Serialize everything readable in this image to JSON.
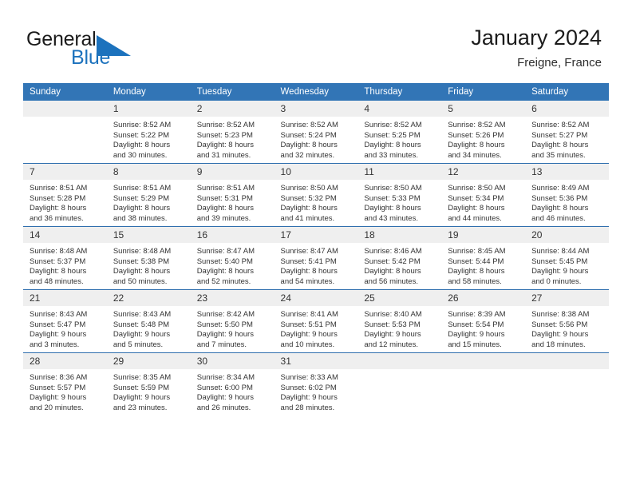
{
  "brand": {
    "name_part1": "General",
    "name_part2": "Blue",
    "triangle_color": "#1c72bd",
    "icon": "triangle-logo-icon"
  },
  "header": {
    "title": "January 2024",
    "location": "Freigne, France"
  },
  "theme": {
    "header_row_bg": "#3275b6",
    "daynum_bg": "#efefef",
    "row_divider": "#2f6fae",
    "accent": "#1c72bd"
  },
  "calendar": {
    "weekday_headers": [
      "Sunday",
      "Monday",
      "Tuesday",
      "Wednesday",
      "Thursday",
      "Friday",
      "Saturday"
    ],
    "weeks": [
      [
        {
          "day": "",
          "sunrise": "",
          "sunset": "",
          "daylight_line1": "",
          "daylight_line2": ""
        },
        {
          "day": "1",
          "sunrise": "Sunrise: 8:52 AM",
          "sunset": "Sunset: 5:22 PM",
          "daylight_line1": "Daylight: 8 hours",
          "daylight_line2": "and 30 minutes."
        },
        {
          "day": "2",
          "sunrise": "Sunrise: 8:52 AM",
          "sunset": "Sunset: 5:23 PM",
          "daylight_line1": "Daylight: 8 hours",
          "daylight_line2": "and 31 minutes."
        },
        {
          "day": "3",
          "sunrise": "Sunrise: 8:52 AM",
          "sunset": "Sunset: 5:24 PM",
          "daylight_line1": "Daylight: 8 hours",
          "daylight_line2": "and 32 minutes."
        },
        {
          "day": "4",
          "sunrise": "Sunrise: 8:52 AM",
          "sunset": "Sunset: 5:25 PM",
          "daylight_line1": "Daylight: 8 hours",
          "daylight_line2": "and 33 minutes."
        },
        {
          "day": "5",
          "sunrise": "Sunrise: 8:52 AM",
          "sunset": "Sunset: 5:26 PM",
          "daylight_line1": "Daylight: 8 hours",
          "daylight_line2": "and 34 minutes."
        },
        {
          "day": "6",
          "sunrise": "Sunrise: 8:52 AM",
          "sunset": "Sunset: 5:27 PM",
          "daylight_line1": "Daylight: 8 hours",
          "daylight_line2": "and 35 minutes."
        }
      ],
      [
        {
          "day": "7",
          "sunrise": "Sunrise: 8:51 AM",
          "sunset": "Sunset: 5:28 PM",
          "daylight_line1": "Daylight: 8 hours",
          "daylight_line2": "and 36 minutes."
        },
        {
          "day": "8",
          "sunrise": "Sunrise: 8:51 AM",
          "sunset": "Sunset: 5:29 PM",
          "daylight_line1": "Daylight: 8 hours",
          "daylight_line2": "and 38 minutes."
        },
        {
          "day": "9",
          "sunrise": "Sunrise: 8:51 AM",
          "sunset": "Sunset: 5:31 PM",
          "daylight_line1": "Daylight: 8 hours",
          "daylight_line2": "and 39 minutes."
        },
        {
          "day": "10",
          "sunrise": "Sunrise: 8:50 AM",
          "sunset": "Sunset: 5:32 PM",
          "daylight_line1": "Daylight: 8 hours",
          "daylight_line2": "and 41 minutes."
        },
        {
          "day": "11",
          "sunrise": "Sunrise: 8:50 AM",
          "sunset": "Sunset: 5:33 PM",
          "daylight_line1": "Daylight: 8 hours",
          "daylight_line2": "and 43 minutes."
        },
        {
          "day": "12",
          "sunrise": "Sunrise: 8:50 AM",
          "sunset": "Sunset: 5:34 PM",
          "daylight_line1": "Daylight: 8 hours",
          "daylight_line2": "and 44 minutes."
        },
        {
          "day": "13",
          "sunrise": "Sunrise: 8:49 AM",
          "sunset": "Sunset: 5:36 PM",
          "daylight_line1": "Daylight: 8 hours",
          "daylight_line2": "and 46 minutes."
        }
      ],
      [
        {
          "day": "14",
          "sunrise": "Sunrise: 8:48 AM",
          "sunset": "Sunset: 5:37 PM",
          "daylight_line1": "Daylight: 8 hours",
          "daylight_line2": "and 48 minutes."
        },
        {
          "day": "15",
          "sunrise": "Sunrise: 8:48 AM",
          "sunset": "Sunset: 5:38 PM",
          "daylight_line1": "Daylight: 8 hours",
          "daylight_line2": "and 50 minutes."
        },
        {
          "day": "16",
          "sunrise": "Sunrise: 8:47 AM",
          "sunset": "Sunset: 5:40 PM",
          "daylight_line1": "Daylight: 8 hours",
          "daylight_line2": "and 52 minutes."
        },
        {
          "day": "17",
          "sunrise": "Sunrise: 8:47 AM",
          "sunset": "Sunset: 5:41 PM",
          "daylight_line1": "Daylight: 8 hours",
          "daylight_line2": "and 54 minutes."
        },
        {
          "day": "18",
          "sunrise": "Sunrise: 8:46 AM",
          "sunset": "Sunset: 5:42 PM",
          "daylight_line1": "Daylight: 8 hours",
          "daylight_line2": "and 56 minutes."
        },
        {
          "day": "19",
          "sunrise": "Sunrise: 8:45 AM",
          "sunset": "Sunset: 5:44 PM",
          "daylight_line1": "Daylight: 8 hours",
          "daylight_line2": "and 58 minutes."
        },
        {
          "day": "20",
          "sunrise": "Sunrise: 8:44 AM",
          "sunset": "Sunset: 5:45 PM",
          "daylight_line1": "Daylight: 9 hours",
          "daylight_line2": "and 0 minutes."
        }
      ],
      [
        {
          "day": "21",
          "sunrise": "Sunrise: 8:43 AM",
          "sunset": "Sunset: 5:47 PM",
          "daylight_line1": "Daylight: 9 hours",
          "daylight_line2": "and 3 minutes."
        },
        {
          "day": "22",
          "sunrise": "Sunrise: 8:43 AM",
          "sunset": "Sunset: 5:48 PM",
          "daylight_line1": "Daylight: 9 hours",
          "daylight_line2": "and 5 minutes."
        },
        {
          "day": "23",
          "sunrise": "Sunrise: 8:42 AM",
          "sunset": "Sunset: 5:50 PM",
          "daylight_line1": "Daylight: 9 hours",
          "daylight_line2": "and 7 minutes."
        },
        {
          "day": "24",
          "sunrise": "Sunrise: 8:41 AM",
          "sunset": "Sunset: 5:51 PM",
          "daylight_line1": "Daylight: 9 hours",
          "daylight_line2": "and 10 minutes."
        },
        {
          "day": "25",
          "sunrise": "Sunrise: 8:40 AM",
          "sunset": "Sunset: 5:53 PM",
          "daylight_line1": "Daylight: 9 hours",
          "daylight_line2": "and 12 minutes."
        },
        {
          "day": "26",
          "sunrise": "Sunrise: 8:39 AM",
          "sunset": "Sunset: 5:54 PM",
          "daylight_line1": "Daylight: 9 hours",
          "daylight_line2": "and 15 minutes."
        },
        {
          "day": "27",
          "sunrise": "Sunrise: 8:38 AM",
          "sunset": "Sunset: 5:56 PM",
          "daylight_line1": "Daylight: 9 hours",
          "daylight_line2": "and 18 minutes."
        }
      ],
      [
        {
          "day": "28",
          "sunrise": "Sunrise: 8:36 AM",
          "sunset": "Sunset: 5:57 PM",
          "daylight_line1": "Daylight: 9 hours",
          "daylight_line2": "and 20 minutes."
        },
        {
          "day": "29",
          "sunrise": "Sunrise: 8:35 AM",
          "sunset": "Sunset: 5:59 PM",
          "daylight_line1": "Daylight: 9 hours",
          "daylight_line2": "and 23 minutes."
        },
        {
          "day": "30",
          "sunrise": "Sunrise: 8:34 AM",
          "sunset": "Sunset: 6:00 PM",
          "daylight_line1": "Daylight: 9 hours",
          "daylight_line2": "and 26 minutes."
        },
        {
          "day": "31",
          "sunrise": "Sunrise: 8:33 AM",
          "sunset": "Sunset: 6:02 PM",
          "daylight_line1": "Daylight: 9 hours",
          "daylight_line2": "and 28 minutes."
        },
        {
          "day": "",
          "sunrise": "",
          "sunset": "",
          "daylight_line1": "",
          "daylight_line2": ""
        },
        {
          "day": "",
          "sunrise": "",
          "sunset": "",
          "daylight_line1": "",
          "daylight_line2": ""
        },
        {
          "day": "",
          "sunrise": "",
          "sunset": "",
          "daylight_line1": "",
          "daylight_line2": ""
        }
      ]
    ]
  }
}
